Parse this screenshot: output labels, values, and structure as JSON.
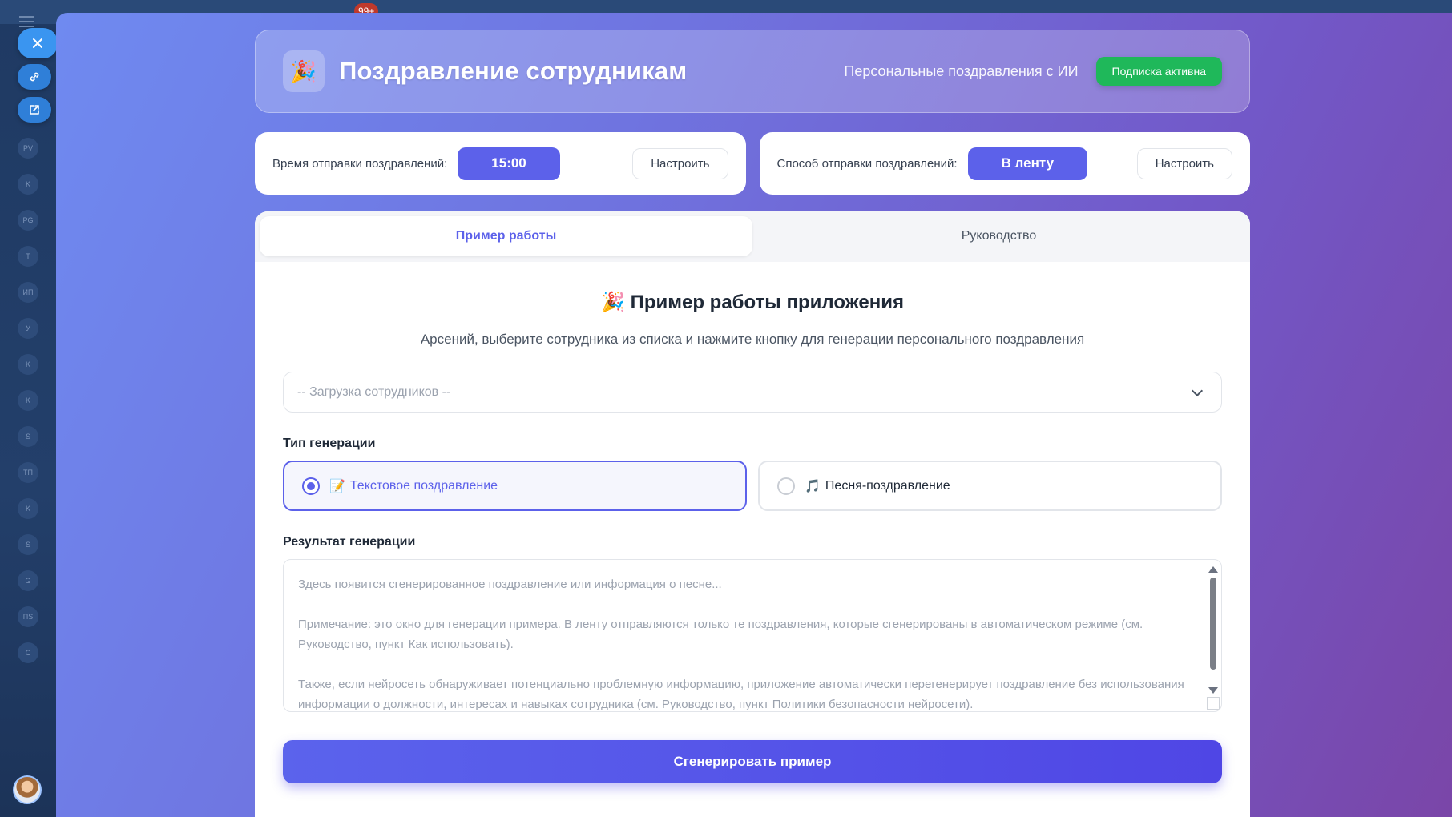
{
  "background": {
    "badge": "99+",
    "sidebar_initials": [
      "PV",
      "K",
      "PG",
      "T",
      "ИП",
      "У",
      "K",
      "K",
      "S",
      "TП",
      "K",
      "S",
      "G",
      "ПS",
      "C"
    ]
  },
  "header": {
    "icon": "party-popper-icon",
    "title": "Поздравление сотрудникам",
    "subtitle": "Персональные поздравления с ИИ",
    "subscription_badge": "Подписка активна"
  },
  "settings": {
    "time": {
      "label": "Время отправки поздравлений:",
      "value": "15:00",
      "button": "Настроить"
    },
    "method": {
      "label": "Способ отправки поздравлений:",
      "value": "В ленту",
      "button": "Настроить"
    }
  },
  "tabs": [
    {
      "label": "Пример работы",
      "active": true
    },
    {
      "label": "Руководство",
      "active": false
    }
  ],
  "panel": {
    "title": "🎉 Пример работы приложения",
    "subtitle": "Арсений, выберите сотрудника из списка и нажмите кнопку для генерации персонального поздравления",
    "employee_select": {
      "selected": "-- Загрузка сотрудников --"
    },
    "generation_type": {
      "label": "Тип генерации",
      "options": [
        {
          "emoji": "📝",
          "label": "Текстовое поздравление",
          "selected": true
        },
        {
          "emoji": "🎵",
          "label": "Песня-поздравление",
          "selected": false
        }
      ]
    },
    "result": {
      "label": "Результат генерации",
      "placeholder_lines": [
        "Здесь появится сгенерированное поздравление или информация о песне...",
        "Примечание: это окно для генерации примера. В ленту отправляются только те поздравления, которые сгенерированы в автоматическом режиме (см. Руководство, пункт Как использовать).",
        "Также, если нейросеть обнаруживает потенциально проблемную информацию, приложение автоматически перегенерирует поздравление без использования информации о должности, интересах и навыках сотрудника (см. Руководство, пункт Политики безопасности нейросети)."
      ]
    },
    "generate_button": "Сгенерировать пример"
  },
  "colors": {
    "accent": "#5c61ea",
    "success": "#1fb85a",
    "gradient_start": "#6f8af0",
    "gradient_end": "#7a46a8"
  }
}
